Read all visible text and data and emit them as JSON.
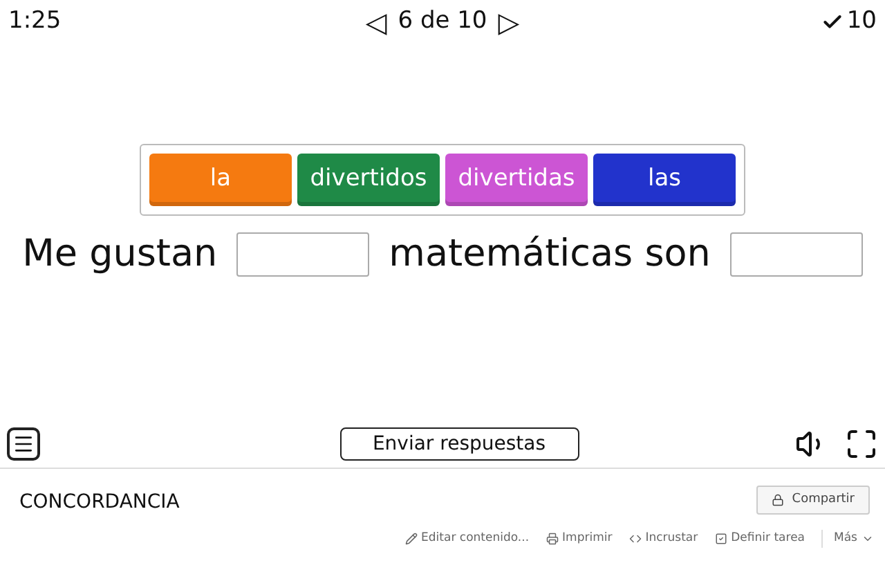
{
  "top_bar": {
    "timer": "1:25",
    "prev": "◁",
    "page": "6 de 10",
    "next": "▷",
    "score": "10"
  },
  "tiles": [
    {
      "label": "la",
      "color": "#f57a10"
    },
    {
      "label": "divertidos",
      "color": "#1f8a47"
    },
    {
      "label": "divertidas",
      "color": "#cc55d4"
    },
    {
      "label": "las",
      "color": "#2233cc"
    }
  ],
  "sentence": [
    {
      "kind": "text",
      "text": "Me gustan"
    },
    {
      "kind": "blank"
    },
    {
      "kind": "text",
      "text": "matemáticas son"
    },
    {
      "kind": "blank"
    }
  ],
  "controls": {
    "submit": "Enviar respuestas"
  },
  "footer": {
    "title": "CONCORDANCIA",
    "share": "Compartir",
    "actions": [
      {
        "kind": "edit",
        "label": "Editar contenido..."
      },
      {
        "kind": "print",
        "label": "Imprimir"
      },
      {
        "kind": "embed",
        "label": "Incrustar"
      },
      {
        "kind": "assign",
        "label": "Definir tarea"
      },
      {
        "kind": "more",
        "label": "Más"
      }
    ]
  }
}
